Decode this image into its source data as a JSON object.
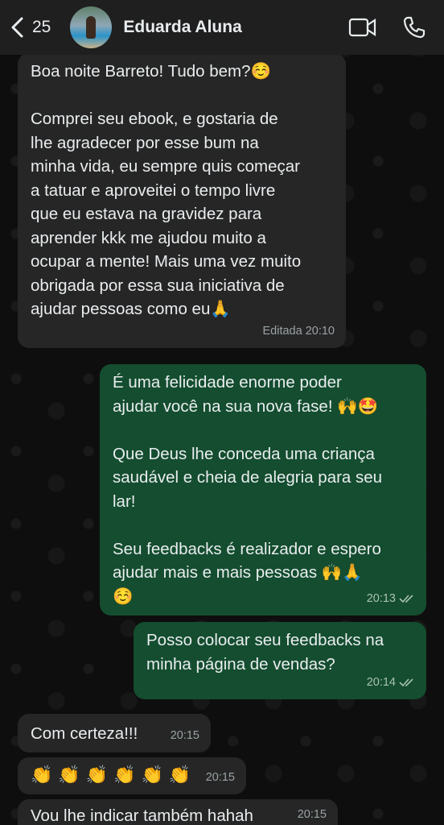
{
  "header": {
    "back_count": "25",
    "contact_name": "Eduarda Aluna"
  },
  "messages": [
    {
      "direction": "incoming",
      "text": "Boa noite Barreto! Tudo bem?☺️\n\nComprei seu ebook, e gostaria de\nlhe agradecer por esse bum na\nminha vida, eu sempre quis começar\na tatuar e aproveitei o tempo livre\nque eu estava na gravidez para\naprender kkk me ajudou muito a\nocupar a mente! Mais uma vez muito\nobrigada por essa sua iniciativa de\najudar pessoas como eu🙏",
      "meta": "Editada 20:10"
    },
    {
      "direction": "outgoing",
      "text": "É uma felicidade enorme poder\najudar você na sua nova fase! 🙌🤩\n\nQue Deus lhe conceda uma criança\nsaudável e cheia de alegria para seu\nlar!\n\nSeu feedbacks é realizador e espero\najudar mais e mais pessoas 🙌🙏\n☺️",
      "meta": "20:13"
    },
    {
      "direction": "outgoing",
      "text": "Posso colocar seu feedbacks na\nminha página de vendas?",
      "meta": "20:14"
    },
    {
      "direction": "incoming",
      "text": "Com certeza!!!",
      "meta": "20:15"
    },
    {
      "direction": "incoming",
      "text": "👏 👏 👏 👏 👏 👏",
      "meta": "20:15"
    },
    {
      "direction": "incoming",
      "text": "Vou lhe indicar também hahah",
      "meta": "20:15"
    }
  ]
}
